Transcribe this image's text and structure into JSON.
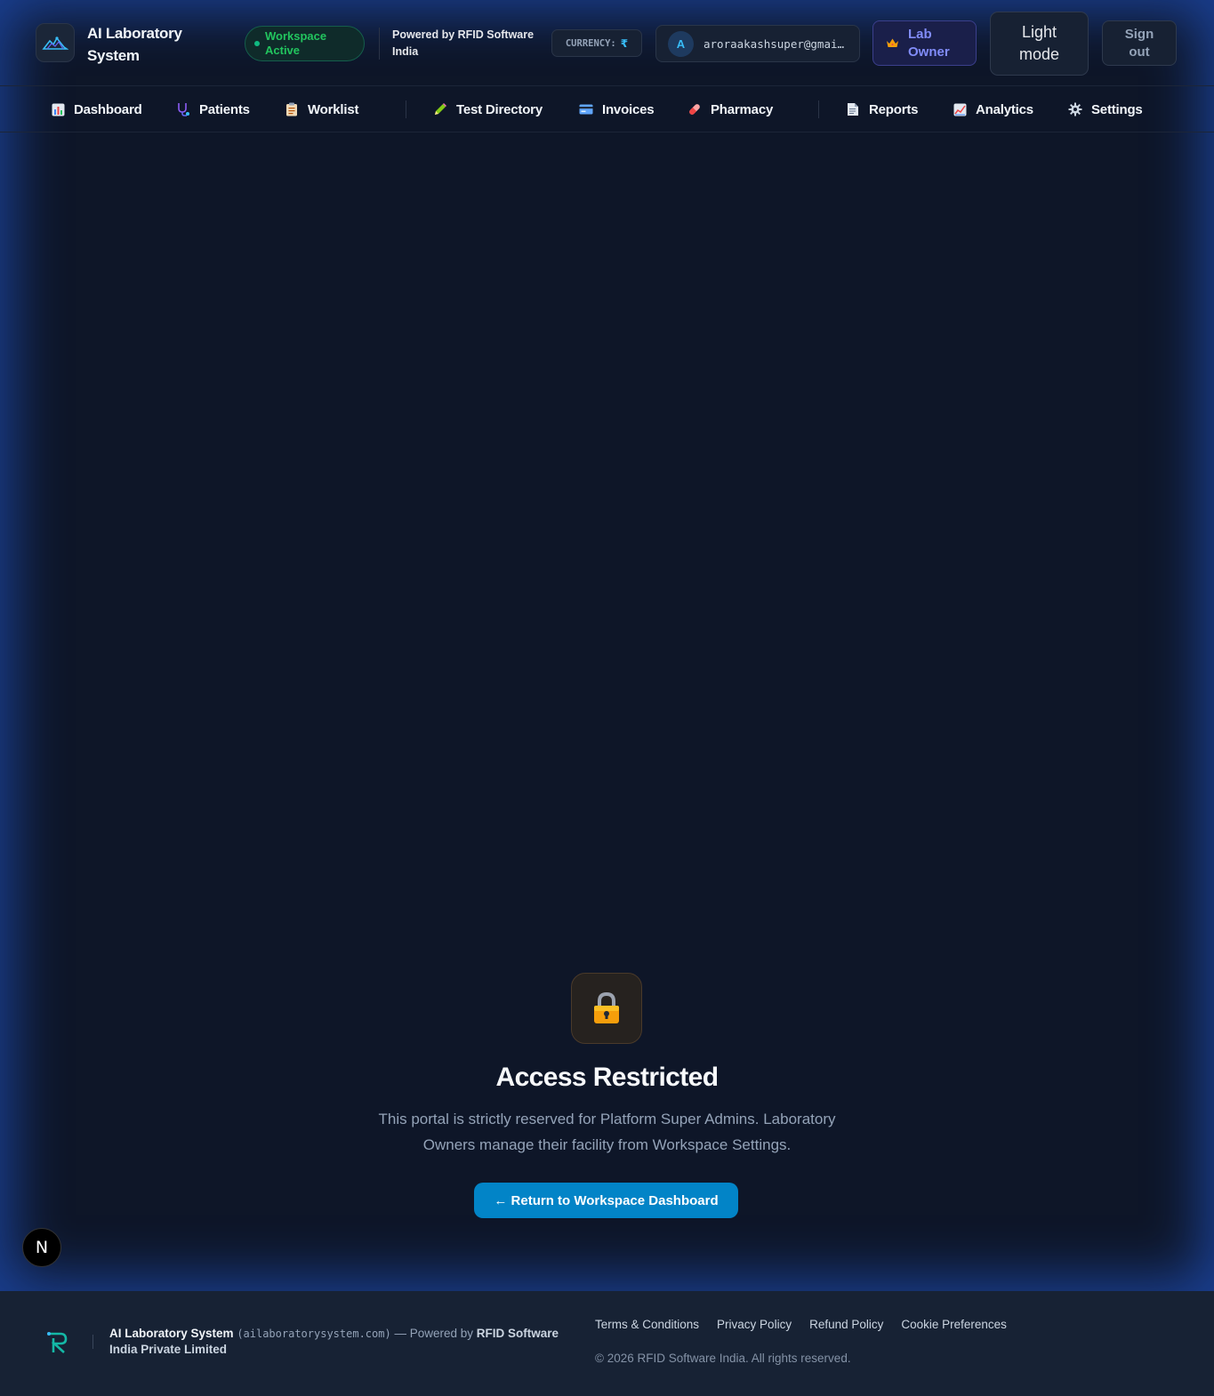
{
  "header": {
    "brand": "AI Laboratory System",
    "workspace_status": "Workspace Active",
    "powered_by": "Powered by RFID Software India",
    "currency_label": "CURRENCY:",
    "currency_symbol": "₹",
    "user_initial": "A",
    "user_email": "aroraakashsuper@gmail.com",
    "role": "Lab Owner",
    "theme_toggle": "Light mode",
    "sign_out": "Sign out"
  },
  "nav": {
    "items": [
      {
        "label": "Dashboard",
        "icon": "bar-chart-icon"
      },
      {
        "label": "Patients",
        "icon": "stethoscope-icon"
      },
      {
        "label": "Worklist",
        "icon": "clipboard-icon"
      },
      {
        "label": "Test Directory",
        "icon": "pencil-icon"
      },
      {
        "label": "Invoices",
        "icon": "credit-card-icon"
      },
      {
        "label": "Pharmacy",
        "icon": "pill-icon"
      },
      {
        "label": "Reports",
        "icon": "document-icon"
      },
      {
        "label": "Analytics",
        "icon": "line-chart-icon"
      },
      {
        "label": "Settings",
        "icon": "gear-icon"
      }
    ]
  },
  "main": {
    "icon": "lock-icon",
    "title": "Access Restricted",
    "description": "This portal is strictly reserved for Platform Super Admins. Laboratory Owners manage their facility from Workspace Settings.",
    "return_button": "← Return to Workspace Dashboard"
  },
  "dev_badge": "N",
  "footer": {
    "brand": "AI Laboratory System",
    "domain": "(ailaboratorysystem.com)",
    "powered_prefix": " — Powered by ",
    "company": "RFID Software India Private Limited",
    "links": [
      "Terms & Conditions",
      "Privacy Policy",
      "Refund Policy",
      "Cookie Preferences"
    ],
    "copyright": "© 2026 RFID Software India. All rights reserved."
  },
  "colors": {
    "accent": "#0284c7",
    "success": "#22c55e",
    "role": "#818cf8",
    "background": "#0e1628"
  }
}
